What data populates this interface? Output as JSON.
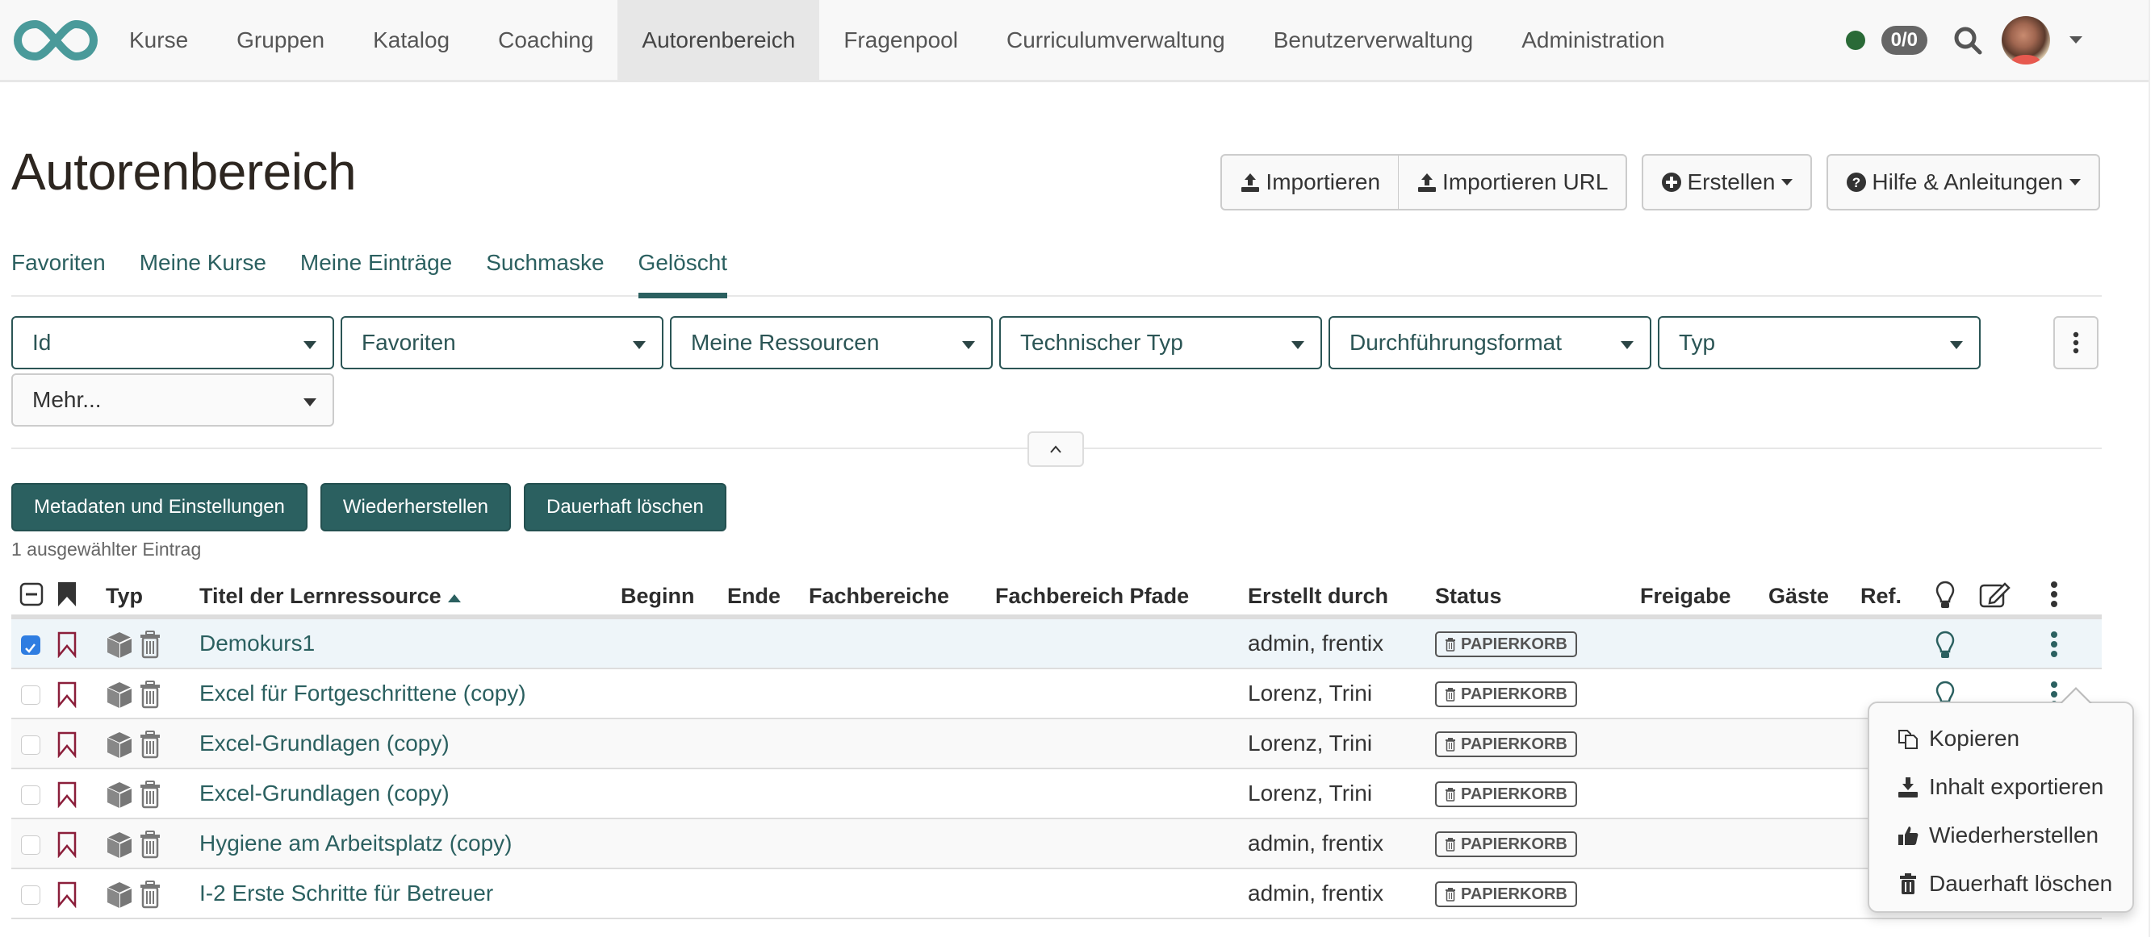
{
  "navbar": {
    "items": [
      {
        "label": "Kurse",
        "active": false
      },
      {
        "label": "Gruppen",
        "active": false
      },
      {
        "label": "Katalog",
        "active": false
      },
      {
        "label": "Coaching",
        "active": false
      },
      {
        "label": "Autorenbereich",
        "active": true
      },
      {
        "label": "Fragenpool",
        "active": false
      },
      {
        "label": "Curriculumverwaltung",
        "active": false
      },
      {
        "label": "Benutzerverwaltung",
        "active": false
      },
      {
        "label": "Administration",
        "active": false
      }
    ],
    "online_status_color": "#2a6a37",
    "count_badge": "0/0"
  },
  "page": {
    "title": "Autorenbereich"
  },
  "toolbar": {
    "import_label": "Importieren",
    "import_url_label": "Importieren URL",
    "create_label": "Erstellen",
    "help_label": "Hilfe & Anleitungen"
  },
  "tabs": [
    {
      "label": "Favoriten",
      "active": false
    },
    {
      "label": "Meine Kurse",
      "active": false
    },
    {
      "label": "Meine Einträge",
      "active": false
    },
    {
      "label": "Suchmaske",
      "active": false
    },
    {
      "label": "Gelöscht",
      "active": true
    }
  ],
  "filters": [
    {
      "label": "Id"
    },
    {
      "label": "Favoriten"
    },
    {
      "label": "Meine Ressourcen"
    },
    {
      "label": "Technischer Typ"
    },
    {
      "label": "Durchführungsformat"
    },
    {
      "label": "Typ"
    },
    {
      "label": "Mehr..."
    }
  ],
  "actions": {
    "metadata_label": "Metadaten und Einstellungen",
    "restore_label": "Wiederherstellen",
    "delete_label": "Dauerhaft löschen"
  },
  "selection_info": "1 ausgewählter Eintrag",
  "table": {
    "headers": {
      "type": "Typ",
      "title": "Titel der Lernressource",
      "begin": "Beginn",
      "end": "Ende",
      "subjects": "Fachbereiche",
      "subject_paths": "Fachbereich Pfade",
      "created_by": "Erstellt durch",
      "status": "Status",
      "release": "Freigabe",
      "guests": "Gäste",
      "ref": "Ref."
    },
    "sort": {
      "column": "title",
      "direction": "ascending"
    },
    "rows": [
      {
        "title": "Demokurs1",
        "created_by": "admin, frentix",
        "status": "PAPIERKORB",
        "selected": true
      },
      {
        "title": "Excel für Fortgeschrittene (copy)",
        "created_by": "Lorenz, Trini",
        "status": "PAPIERKORB",
        "selected": false
      },
      {
        "title": "Excel-Grundlagen (copy)",
        "created_by": "Lorenz, Trini",
        "status": "PAPIERKORB",
        "selected": false
      },
      {
        "title": "Excel-Grundlagen (copy)",
        "created_by": "Lorenz, Trini",
        "status": "PAPIERKORB",
        "selected": false
      },
      {
        "title": "Hygiene am Arbeitsplatz (copy)",
        "created_by": "admin, frentix",
        "status": "PAPIERKORB",
        "selected": false
      },
      {
        "title": "I-2 Erste Schritte für Betreuer",
        "created_by": "admin, frentix",
        "status": "PAPIERKORB",
        "selected": false
      }
    ]
  },
  "context_menu": {
    "items": [
      {
        "label": "Kopieren",
        "icon": "copy-icon"
      },
      {
        "label": "Inhalt exportieren",
        "icon": "download-icon"
      },
      {
        "label": "Wiederherstellen",
        "icon": "thumbs-up-icon"
      },
      {
        "label": "Dauerhaft löschen",
        "icon": "trash-icon"
      }
    ]
  },
  "colors": {
    "brand": "#4a9a9a",
    "primary": "#2b6060",
    "bookmark": "#8b1e3a",
    "checkbox_checked": "#2f7de1"
  }
}
